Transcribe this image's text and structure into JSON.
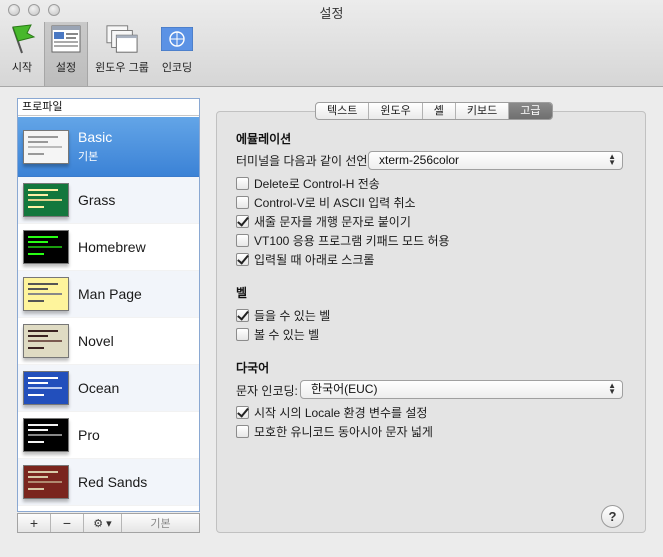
{
  "window": {
    "title": "설정"
  },
  "toolbar": {
    "items": [
      {
        "label": "시작",
        "icon": "green-flag-icon"
      },
      {
        "label": "설정",
        "icon": "profiles-icon",
        "selected": true
      },
      {
        "label": "윈도우 그룹",
        "icon": "window-groups-icon"
      },
      {
        "label": "인코딩",
        "icon": "un-globe-icon"
      }
    ]
  },
  "sidebar": {
    "header": "프로파일",
    "profiles": [
      {
        "name": "Basic",
        "sub": "기본",
        "bg": "#f5f5f5",
        "fg": "#333"
      },
      {
        "name": "Grass",
        "bg": "#13773d",
        "fg": "#fff0a5"
      },
      {
        "name": "Homebrew",
        "bg": "#000000",
        "fg": "#28fe14"
      },
      {
        "name": "Man Page",
        "bg": "#fef49c",
        "fg": "#000"
      },
      {
        "name": "Novel",
        "bg": "#dfdbc3",
        "fg": "#3b2322"
      },
      {
        "name": "Ocean",
        "bg": "#224fbc",
        "fg": "#fff"
      },
      {
        "name": "Pro",
        "bg": "#000000",
        "fg": "#f2f2f2"
      },
      {
        "name": "Red Sands",
        "bg": "#7a251e",
        "fg": "#d7c9a7"
      }
    ],
    "bottom": {
      "add": "+",
      "remove": "−",
      "gear": "⚙ ▾",
      "default_label": "기본"
    }
  },
  "tabs": [
    "텍스트",
    "윈도우",
    "셸",
    "키보드",
    "고급"
  ],
  "active_tab": "고급",
  "emulation": {
    "title": "에뮬레이션",
    "declare_label": "터미널을 다음과 같이 선언:",
    "declare_value": "xterm-256color",
    "options": [
      {
        "label": "Delete로 Control-H 전송",
        "checked": false
      },
      {
        "label": "Control-V로 비 ASCII 입력 취소",
        "checked": false
      },
      {
        "label": "새줄 문자를 개행 문자로 붙이기",
        "checked": true
      },
      {
        "label": "VT100 응용 프로그램 키패드 모드 허용",
        "checked": false
      },
      {
        "label": "입력될 때 아래로 스크롤",
        "checked": true
      }
    ]
  },
  "bell": {
    "title": "벨",
    "options": [
      {
        "label": "들을 수 있는 벨",
        "checked": true
      },
      {
        "label": "볼 수 있는 벨",
        "checked": false
      }
    ]
  },
  "intl": {
    "title": "다국어",
    "encoding_label": "문자 인코딩:",
    "encoding_value": "한국어(EUC)",
    "options": [
      {
        "label": "시작 시의 Locale 환경 변수를 설정",
        "checked": true
      },
      {
        "label": "모호한 유니코드 동아시아 문자 넓게",
        "checked": false
      }
    ]
  },
  "help": {
    "label": "?"
  }
}
